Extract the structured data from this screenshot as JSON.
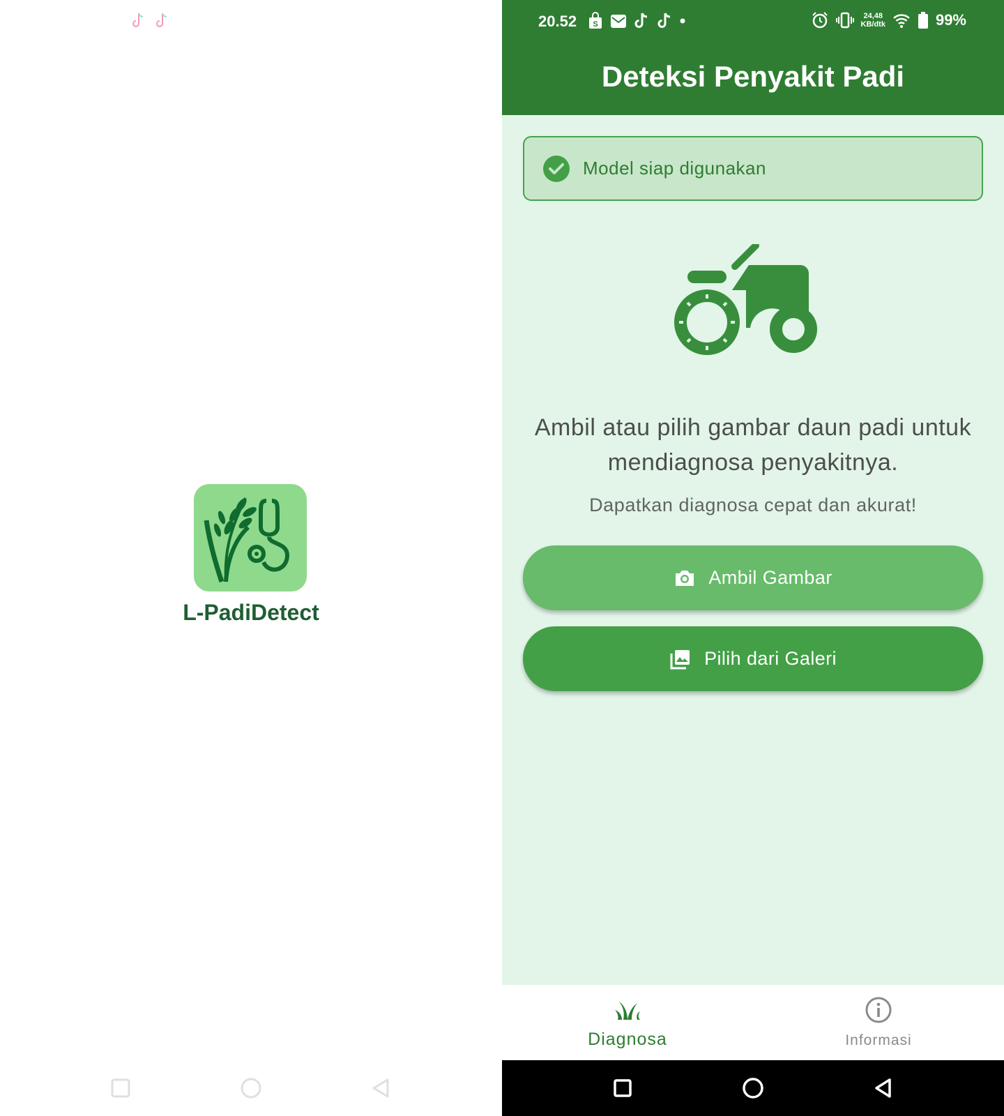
{
  "splash": {
    "app_name": "L-PadiDetect",
    "logo_icon": "rice-stethoscope-logo",
    "notification_icons": [
      "tiktok-icon",
      "tiktok-icon"
    ]
  },
  "status_bar": {
    "time": "20.52",
    "net_speed_value": "24,48",
    "net_speed_unit": "KB/dtk",
    "battery": "99%"
  },
  "app_bar": {
    "title": "Deteksi Penyakit Padi"
  },
  "model_status": {
    "text": "Model siap digunakan",
    "icon": "check-circle-icon"
  },
  "hero": {
    "icon": "tractor-icon",
    "headline": "Ambil atau pilih gambar daun padi untuk mendiagnosa penyakitnya.",
    "subline": "Dapatkan diagnosa cepat dan akurat!"
  },
  "actions": {
    "camera_label": "Ambil Gambar",
    "gallery_label": "Pilih dari Galeri"
  },
  "bottom_nav": {
    "items": [
      {
        "label": "Diagnosa",
        "icon": "grass-icon",
        "active": true
      },
      {
        "label": "Informasi",
        "icon": "info-icon",
        "active": false
      }
    ]
  },
  "colors": {
    "primary": "#2f7d33",
    "background": "#e2f5e8",
    "banner_bg": "#c8e6c9",
    "camera_button": "#67bb6a",
    "gallery_button": "#43a047"
  }
}
